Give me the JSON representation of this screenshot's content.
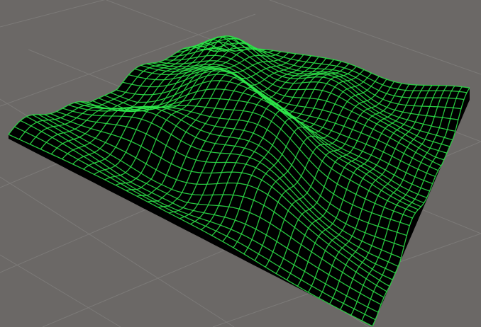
{
  "scene": {
    "kind": "3d-viewport",
    "object": "terrain-mesh",
    "render_style": "wireframe-over-solid",
    "colors": {
      "background": "#6b6866",
      "ground_grid": "#7c7a78",
      "mesh_fill": "#000000",
      "wire": "#2ee84a",
      "wire_dim": "#0f6a1f"
    }
  }
}
